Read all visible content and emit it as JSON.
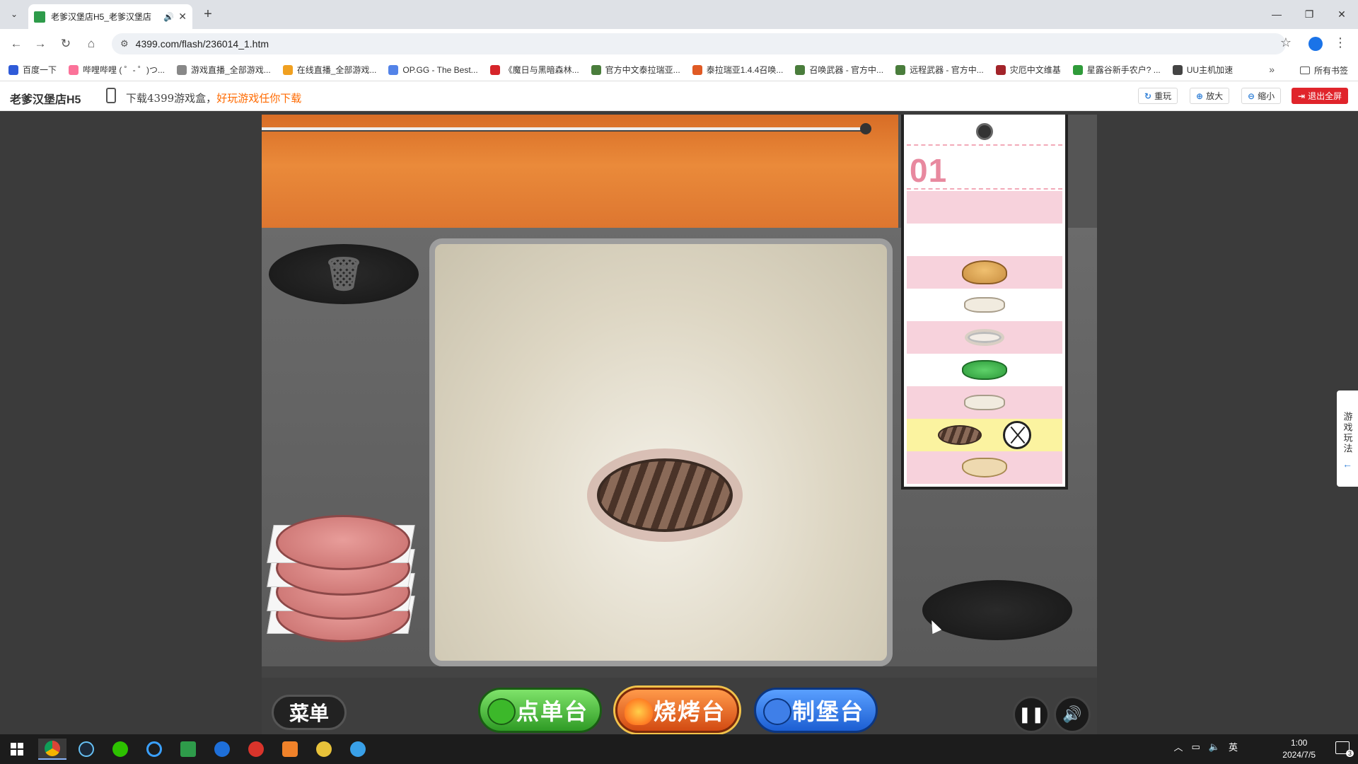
{
  "browser": {
    "tab_title": "老爹汉堡店H5_老爹汉堡店",
    "new_tab_label": "+",
    "url": "4399.com/flash/236014_1.htm",
    "bookmarks": [
      {
        "label": "百度一下",
        "color": "#2f5bd8"
      },
      {
        "label": "哔哩哔哩 ( ゜- ゜)つ...",
        "color": "#fb7299"
      },
      {
        "label": "游戏直播_全部游戏...",
        "color": "#888888"
      },
      {
        "label": "在线直播_全部游戏...",
        "color": "#f0a020"
      },
      {
        "label": "OP.GG - The Best...",
        "color": "#5383e8"
      },
      {
        "label": "《魔日与黑暗森林...",
        "color": "#d6242a"
      },
      {
        "label": "官方中文泰拉瑞亚...",
        "color": "#4a7d3c"
      },
      {
        "label": "泰拉瑞亚1.4.4召唤...",
        "color": "#e05a24"
      },
      {
        "label": "召唤武器 - 官方中...",
        "color": "#4a7d3c"
      },
      {
        "label": "远程武器 - 官方中...",
        "color": "#4a7d3c"
      },
      {
        "label": "灾厄中文维基",
        "color": "#a3242a"
      },
      {
        "label": "星露谷新手农户? ...",
        "color": "#2f9b3a"
      },
      {
        "label": "UU主机加速",
        "color": "#444444"
      }
    ],
    "bookmarks_more": "»",
    "all_bookmarks": "所有书签"
  },
  "page_header": {
    "game_name": "老爹汉堡店H5",
    "promo_text": "下载4399游戏盒，",
    "promo_highlight": "好玩游戏任你下载",
    "buttons": {
      "replay": "重玩",
      "zoom_in": "放大",
      "zoom_out": "缩小",
      "exit_fullscreen": "退出全屏"
    },
    "side_tab": "游戏玩法"
  },
  "game": {
    "ticket_number": "01",
    "order_items": [
      {
        "name": "top-bun",
        "bg": "pink"
      },
      {
        "name": "cheese",
        "bg": "white"
      },
      {
        "name": "onion",
        "bg": "pink"
      },
      {
        "name": "lettuce",
        "bg": "white"
      },
      {
        "name": "cheese",
        "bg": "pink"
      },
      {
        "name": "patty",
        "bg": "yellow"
      },
      {
        "name": "bottom-bun",
        "bg": "pink"
      }
    ],
    "menu_label": "菜单",
    "stations": {
      "order": "点单台",
      "grill": "烧烤台",
      "build": "制堡台"
    },
    "pause_symbol": "❚❚",
    "sound_symbol": "🔊"
  },
  "taskbar": {
    "ime": "英",
    "time": "1:00",
    "date": "2024/7/5",
    "notifications": "3"
  }
}
